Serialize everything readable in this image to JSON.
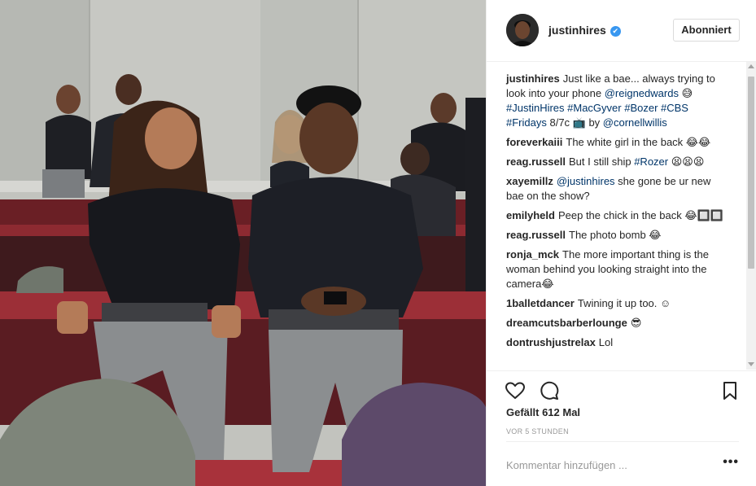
{
  "post": {
    "author": "justinhires",
    "follow_label": "Abonniert",
    "verified_mark": "✔"
  },
  "comments": [
    {
      "user": "justinhires",
      "parts": [
        {
          "t": "Just like a bae... always trying to look into your phone ",
          "tag": false
        },
        {
          "t": "@reignedwards",
          "tag": true
        },
        {
          "t": " 😅 ",
          "tag": false
        },
        {
          "t": "#JustinHires #MacGyver #Bozer #CBS #Fridays",
          "tag": true
        },
        {
          "t": " 8/7c 📺 by ",
          "tag": false
        },
        {
          "t": "@cornellwillis",
          "tag": true
        }
      ]
    },
    {
      "user": "foreverkaiii",
      "parts": [
        {
          "t": "The white girl in the back 😂😂",
          "tag": false
        }
      ]
    },
    {
      "user": "reag.russell",
      "parts": [
        {
          "t": "But I still ship ",
          "tag": false
        },
        {
          "t": "#Rozer",
          "tag": true
        },
        {
          "t": " 😫😫😫",
          "tag": false
        }
      ]
    },
    {
      "user": "xayemillz",
      "parts": [
        {
          "t": "@justinhires",
          "tag": true
        },
        {
          "t": " she gone be ur new bae on the show?",
          "tag": false
        }
      ]
    },
    {
      "user": "emilyheld",
      "parts": [
        {
          "t": "Peep the chick in the back 😂🔲🔲",
          "tag": false
        }
      ]
    },
    {
      "user": "reag.russell",
      "parts": [
        {
          "t": "The photo bomb 😂",
          "tag": false
        }
      ]
    },
    {
      "user": "ronja_mck",
      "parts": [
        {
          "t": "The more important thing is the woman behind you looking straight into the camera😂",
          "tag": false
        }
      ]
    },
    {
      "user": "1balletdancer",
      "parts": [
        {
          "t": "Twining it up too. ☺",
          "tag": false
        }
      ]
    },
    {
      "user": "dreamcutsbarberlounge",
      "parts": [
        {
          "t": "😎",
          "tag": false
        }
      ]
    },
    {
      "user": "dontrushjustrelax",
      "parts": [
        {
          "t": "Lol",
          "tag": false
        }
      ]
    }
  ],
  "actions": {
    "likes": "Gefällt 612 Mal",
    "timestamp": "VOR 5 STUNDEN"
  },
  "add_comment": {
    "placeholder": "Kommentar hinzufügen ...",
    "more": "•••"
  },
  "icons": {
    "like": "heart-icon",
    "comment": "comment-bubble-icon",
    "save": "bookmark-icon",
    "more": "more-options-icon",
    "verified": "verified-badge-icon"
  },
  "colors": {
    "link": "#003569",
    "verified": "#3897f0",
    "muted": "#999999",
    "text": "#262626"
  }
}
